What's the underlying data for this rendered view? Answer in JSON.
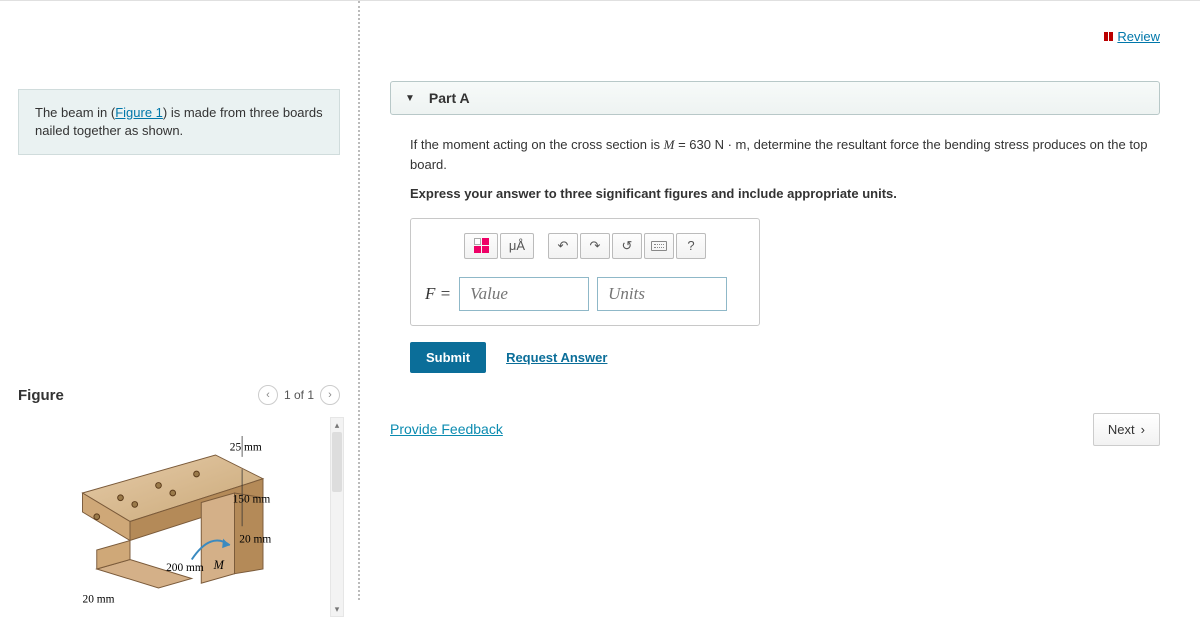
{
  "header": {
    "review_label": "Review"
  },
  "intro": {
    "prefix": "The beam in (",
    "figure_link": "Figure 1",
    "suffix": ") is made from three boards nailed together as shown."
  },
  "figure": {
    "title": "Figure",
    "counter": "1 of 1",
    "dims": {
      "top_thickness": "25 mm",
      "web_height": "150 mm",
      "flange_bottom": "20 mm",
      "width": "200 mm",
      "side_thickness": "20 mm",
      "moment_label": "M"
    }
  },
  "part": {
    "label": "Part A",
    "question_prefix": "If the moment acting on the cross section is ",
    "question_var": "M",
    "question_eq": " = 630 N · m",
    "question_suffix": ", determine the resultant force the bending stress produces on the top board.",
    "instruction": "Express your answer to three significant figures and include appropriate units.",
    "toolbar": {
      "template": "template-icon",
      "format": "μÅ",
      "undo": "↶",
      "redo": "↷",
      "reset": "↺",
      "keyboard": "keyboard-icon",
      "help": "?"
    },
    "answer": {
      "lhs": "F =",
      "value_placeholder": "Value",
      "units_placeholder": "Units"
    },
    "submit_label": "Submit",
    "request_label": "Request Answer"
  },
  "footer": {
    "feedback_label": "Provide Feedback",
    "next_label": "Next"
  }
}
